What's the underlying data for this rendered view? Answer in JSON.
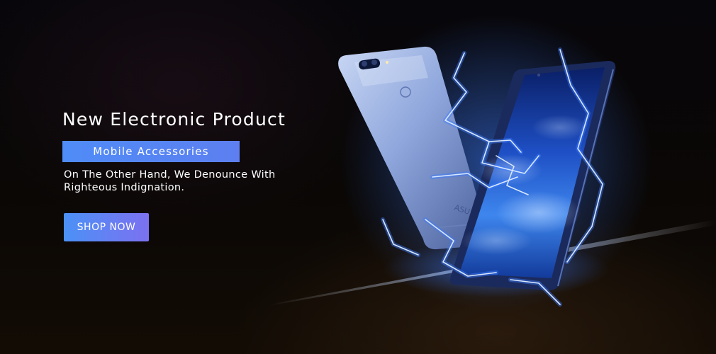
{
  "banner": {
    "headline": "New Electronic Product",
    "tag": "Mobile Accessories",
    "description": "On The Other Hand, We Denounce With Righteous Indignation.",
    "cta": "SHOP NOW",
    "phone_brand": "ASUS",
    "colors": {
      "accent_start": "#4b91f6",
      "accent_end": "#7c71f0",
      "background": "#07060a",
      "lightning": "#3c7bff"
    }
  }
}
